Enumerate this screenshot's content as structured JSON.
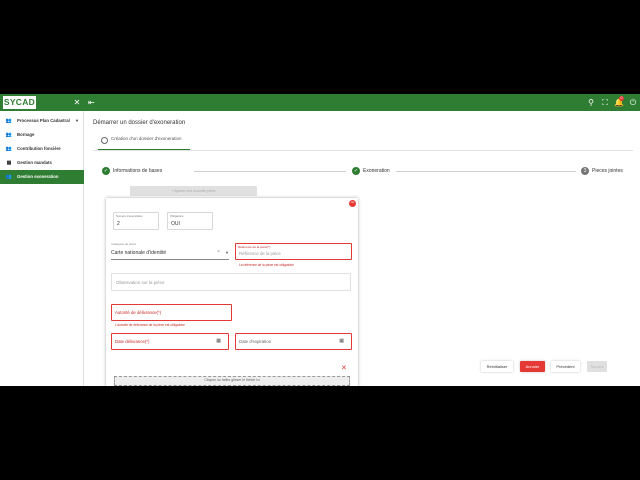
{
  "app": {
    "brand": "SYCAD",
    "notification_count": "0"
  },
  "colors": {
    "primary": "#2e7d32",
    "danger": "#e53935"
  },
  "sidebar": {
    "items": [
      {
        "label": "Processus Plan Cadastral",
        "icon": "people-icon",
        "has_chevron": true
      },
      {
        "label": "Bornage",
        "icon": "people-icon"
      },
      {
        "label": "Contribution foncière",
        "icon": "people-icon"
      },
      {
        "label": "Gestion mandats",
        "icon": "grid-icon"
      },
      {
        "label": "Gestion exoneration",
        "icon": "people-icon",
        "active": true
      }
    ]
  },
  "main": {
    "title": "Démarrer un dossier d'exoneration",
    "tab_label": "Création d'un dossier d'exoneration",
    "steps": [
      {
        "label": "Informations de bases",
        "status": "done"
      },
      {
        "label": "Exoneration",
        "status": "done"
      },
      {
        "label": "Pieces jointes",
        "number": "3",
        "status": "current"
      }
    ],
    "add_button": "+ Ajouter une nouvelle pièce",
    "form": {
      "ordre": {
        "label": "Numero d'exemplaire",
        "value": "2"
      },
      "obligatoire": {
        "label": "Obligatoire",
        "value": "OUI"
      },
      "categorie": {
        "label": "Catégorie de pièce",
        "value": "Carte nationale d'identité"
      },
      "reference": {
        "label": "Référence de la pièce(*)",
        "placeholder": "Référence de la pièce",
        "error": "La référence de la pièce est obligatoire"
      },
      "observation": {
        "placeholder": "Observation sur la pièce"
      },
      "autorite": {
        "placeholder": "Autorité de délivrance(*)",
        "error": "L'autorité de délivrance de la pièce est obligatoire"
      },
      "date_delivrance": {
        "placeholder": "Date délivrance(*)"
      },
      "date_expiration": {
        "placeholder": "Date d'expiration"
      },
      "upload": "Cliquez ou faites glisser le fichier ici"
    },
    "actions": {
      "reset": "Réinitialiser",
      "cancel": "Annuler",
      "previous": "Précédent",
      "next": "Suivant"
    }
  }
}
